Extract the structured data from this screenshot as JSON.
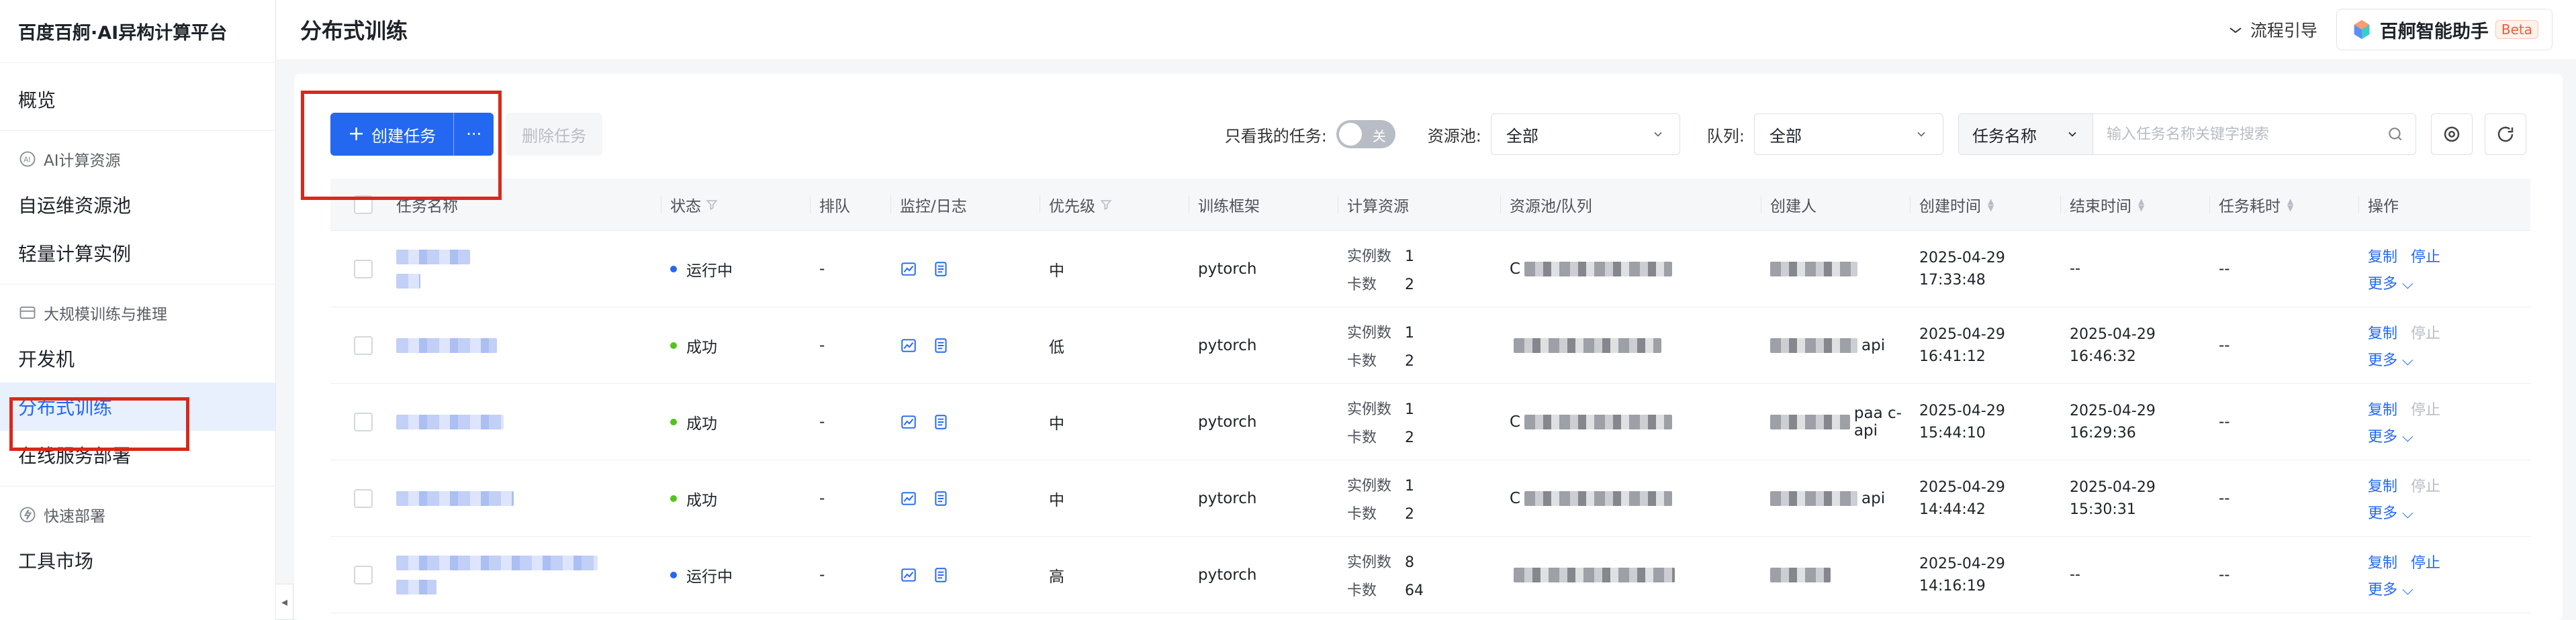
{
  "sidebar": {
    "logo": "百度百舸·AI异构计算平台",
    "items": [
      {
        "type": "item",
        "label": "概览"
      },
      {
        "type": "group",
        "label": "AI计算资源",
        "icon": "cpu-icon"
      },
      {
        "type": "item",
        "label": "自运维资源池"
      },
      {
        "type": "item",
        "label": "轻量计算实例"
      },
      {
        "type": "group",
        "label": "大规模训练与推理",
        "icon": "layers-icon"
      },
      {
        "type": "item",
        "label": "开发机"
      },
      {
        "type": "item",
        "label": "分布式训练",
        "active": true
      },
      {
        "type": "item",
        "label": "在线服务部署"
      },
      {
        "type": "group",
        "label": "快速部署",
        "icon": "lightning-icon"
      },
      {
        "type": "item",
        "label": "工具市场"
      }
    ]
  },
  "header": {
    "title": "分布式训练",
    "guide_label": "流程引导",
    "assistant_label": "百舸智能助手",
    "assistant_badge": "Beta"
  },
  "toolbar": {
    "create_label": "创建任务",
    "create_more": "···",
    "delete_label": "删除任务",
    "only_mine_label": "只看我的任务:",
    "only_mine_toggle": "关",
    "pool_label": "资源池:",
    "pool_value": "全部",
    "queue_label": "队列:",
    "queue_value": "全部",
    "search_type": "任务名称",
    "search_placeholder": "输入任务名称关键字搜索"
  },
  "colors": {
    "primary": "#2468f2",
    "running": "#2468f2",
    "success": "#52c41a",
    "highlight_box": "#d9281c"
  },
  "table": {
    "headers": [
      "任务名称",
      "状态",
      "排队",
      "监控/日志",
      "优先级",
      "训练框架",
      "计算资源",
      "资源池/队列",
      "创建人",
      "创建时间",
      "结束时间",
      "任务耗时",
      "操作"
    ],
    "resource_labels": {
      "instances": "实例数",
      "cards": "卡数"
    },
    "ops_labels": {
      "copy": "复制",
      "stop": "停止",
      "more": "更多"
    },
    "rows": [
      {
        "status": "运行中",
        "status_color": "#2468f2",
        "queue": "-",
        "priority": "中",
        "framework": "pytorch",
        "instances": "1",
        "cards": "2",
        "pool_text": "C",
        "creator_text": "",
        "created": [
          "2025-04-29",
          "17:33:48"
        ],
        "ended": [
          "--"
        ],
        "duration": "--",
        "stop_enabled": true
      },
      {
        "status": "成功",
        "status_color": "#52c41a",
        "queue": "-",
        "priority": "低",
        "framework": "pytorch",
        "instances": "1",
        "cards": "2",
        "pool_text": "",
        "creator_text": "api",
        "created": [
          "2025-04-29",
          "16:41:12"
        ],
        "ended": [
          "2025-04-29",
          "16:46:32"
        ],
        "duration": "--",
        "stop_enabled": false
      },
      {
        "status": "成功",
        "status_color": "#52c41a",
        "queue": "-",
        "priority": "中",
        "framework": "pytorch",
        "instances": "1",
        "cards": "2",
        "pool_text": "C",
        "creator_text": "paa  c-api",
        "created": [
          "2025-04-29",
          "15:44:10"
        ],
        "ended": [
          "2025-04-29",
          "16:29:36"
        ],
        "duration": "--",
        "stop_enabled": false
      },
      {
        "status": "成功",
        "status_color": "#52c41a",
        "queue": "-",
        "priority": "中",
        "framework": "pytorch",
        "instances": "1",
        "cards": "2",
        "pool_text": "C",
        "creator_text": "api",
        "created": [
          "2025-04-29",
          "14:44:42"
        ],
        "ended": [
          "2025-04-29",
          "15:30:31"
        ],
        "duration": "--",
        "stop_enabled": false
      },
      {
        "status": "运行中",
        "status_color": "#2468f2",
        "queue": "-",
        "priority": "高",
        "framework": "pytorch",
        "instances": "8",
        "cards": "64",
        "pool_text": "",
        "creator_text": "",
        "created": [
          "2025-04-29",
          "14:16:19"
        ],
        "ended": [
          "--"
        ],
        "duration": "--",
        "stop_enabled": true
      }
    ]
  }
}
